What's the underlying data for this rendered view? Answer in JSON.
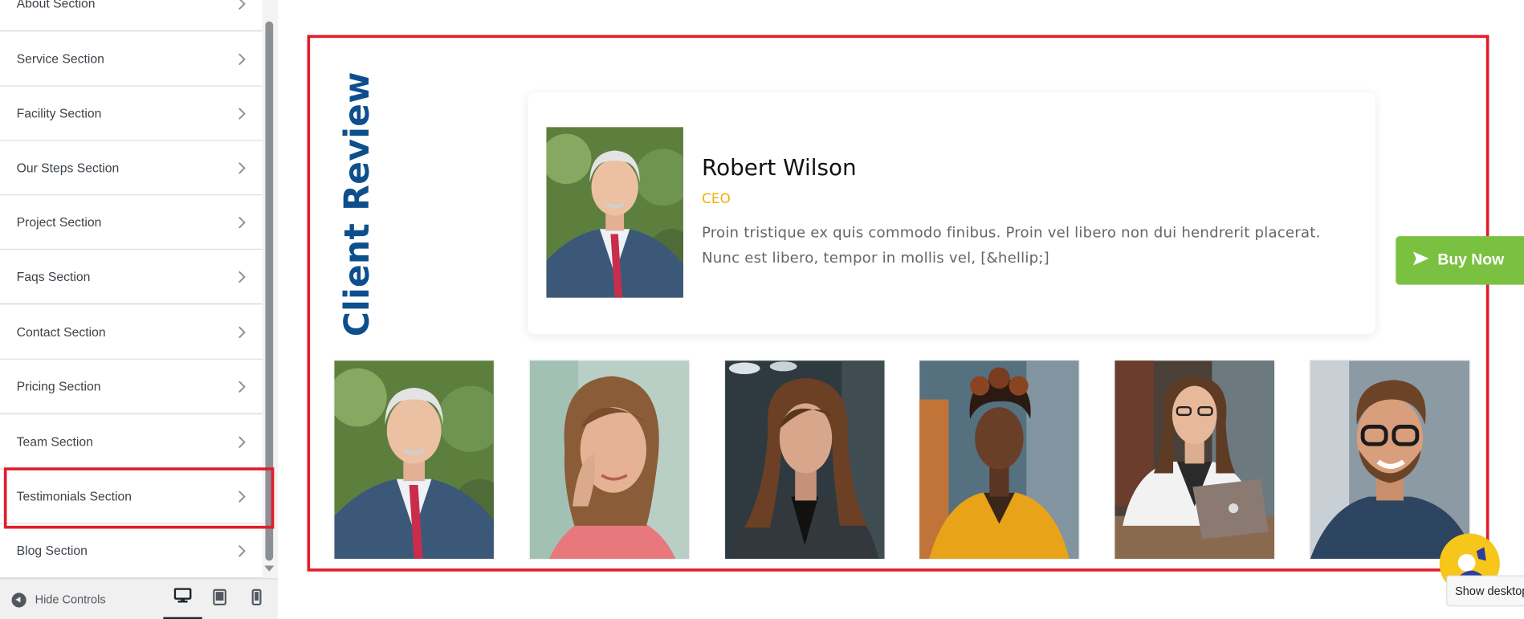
{
  "sidebar": {
    "sections": [
      {
        "label": "About Section"
      },
      {
        "label": "Service Section"
      },
      {
        "label": "Facility Section"
      },
      {
        "label": "Our Steps Section"
      },
      {
        "label": "Project Section"
      },
      {
        "label": "Faqs Section"
      },
      {
        "label": "Contact Section"
      },
      {
        "label": "Pricing Section"
      },
      {
        "label": "Team Section"
      },
      {
        "label": "Testimonials Section"
      },
      {
        "label": "Blog Section"
      }
    ],
    "highlighted_section": "Testimonials Section",
    "footer": {
      "hide_controls_label": "Hide Controls",
      "devices": [
        {
          "icon": "desktop-icon",
          "active": true
        },
        {
          "icon": "tablet-icon",
          "active": false
        },
        {
          "icon": "mobile-icon",
          "active": false
        }
      ]
    }
  },
  "preview": {
    "section_title": "Client Review",
    "testimonial": {
      "name": "Robert Wilson",
      "role": "CEO",
      "text_line1": "Proin tristique ex quis commodo finibus. Proin vel libero non dui hendrerit placerat.",
      "text_line2": "Nunc est libero, tempor in mollis vel, [&hellip;]"
    },
    "thumbnails": [
      {
        "icon": "client-photo-older-man"
      },
      {
        "icon": "client-photo-woman-pink-shirt"
      },
      {
        "icon": "client-photo-woman-dark-blazer"
      },
      {
        "icon": "client-photo-woman-yellow-blazer"
      },
      {
        "icon": "client-photo-woman-laptop"
      },
      {
        "icon": "client-photo-man-glasses"
      }
    ],
    "buy_now_label": "Buy Now",
    "tooltip_text": "Show desktop"
  },
  "colors": {
    "highlight_border": "#e11d2a",
    "title_blue": "#0d4f8c",
    "role_yellow": "#f2b100",
    "buy_now_green": "#7ac142"
  }
}
